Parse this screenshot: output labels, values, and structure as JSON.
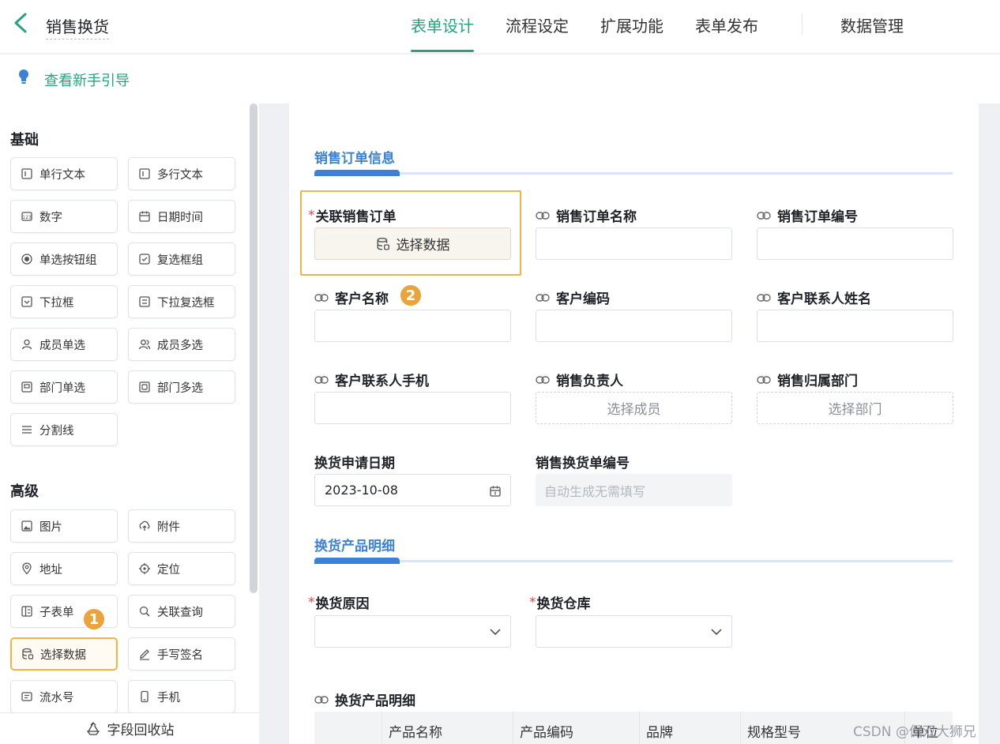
{
  "header": {
    "title": "销售换货",
    "tabs": [
      {
        "label": "表单设计",
        "active": true
      },
      {
        "label": "流程设定"
      },
      {
        "label": "扩展功能"
      },
      {
        "label": "表单发布"
      }
    ],
    "data_tab": "数据管理",
    "accent_color": "#27a37e"
  },
  "guide": {
    "label": "查看新手引导"
  },
  "left_panel": {
    "basic_title": "基础",
    "basic_items": [
      {
        "label": "单行文本",
        "icon": "text-single-icon"
      },
      {
        "label": "多行文本",
        "icon": "text-multi-icon"
      },
      {
        "label": "数字",
        "icon": "number-icon"
      },
      {
        "label": "日期时间",
        "icon": "calendar-icon"
      },
      {
        "label": "单选按钮组",
        "icon": "radio-icon"
      },
      {
        "label": "复选框组",
        "icon": "checkbox-icon"
      },
      {
        "label": "下拉框",
        "icon": "dropdown-icon"
      },
      {
        "label": "下拉复选框",
        "icon": "dropdown-multi-icon"
      },
      {
        "label": "成员单选",
        "icon": "user-icon"
      },
      {
        "label": "成员多选",
        "icon": "users-icon"
      },
      {
        "label": "部门单选",
        "icon": "dept-icon"
      },
      {
        "label": "部门多选",
        "icon": "dept-multi-icon"
      },
      {
        "label": "分割线",
        "icon": "divider-icon"
      }
    ],
    "advanced_title": "高级",
    "advanced_items": [
      {
        "label": "图片",
        "icon": "image-icon"
      },
      {
        "label": "附件",
        "icon": "upload-icon"
      },
      {
        "label": "地址",
        "icon": "pin-icon"
      },
      {
        "label": "定位",
        "icon": "locate-icon"
      },
      {
        "label": "子表单",
        "icon": "subform-icon"
      },
      {
        "label": "关联查询",
        "icon": "query-icon"
      },
      {
        "label": "选择数据",
        "icon": "database-icon",
        "selected": true
      },
      {
        "label": "手写签名",
        "icon": "pen-icon"
      },
      {
        "label": "流水号",
        "icon": "serial-icon"
      },
      {
        "label": "手机",
        "icon": "phone-icon"
      }
    ],
    "recycle_label": "字段回收站",
    "badge_1": "1"
  },
  "form": {
    "section1_title": "销售订单信息",
    "fields_row1": [
      {
        "label": "关联销售订单",
        "required": true,
        "button": "选择数据"
      },
      {
        "label": "销售订单名称",
        "linked": true
      },
      {
        "label": "销售订单编号",
        "linked": true
      }
    ],
    "fields_row2": [
      {
        "label": "客户名称",
        "linked": true
      },
      {
        "label": "客户编码",
        "linked": true
      },
      {
        "label": "客户联系人姓名",
        "linked": true
      }
    ],
    "badge_2": "2",
    "fields_row3": [
      {
        "label": "客户联系人手机",
        "linked": true
      },
      {
        "label": "销售负责人",
        "linked": true,
        "placeholder": "选择成员"
      },
      {
        "label": "销售归属部门",
        "linked": true,
        "placeholder": "选择部门"
      }
    ],
    "date_field": {
      "label": "换货申请日期",
      "value": "2023-10-08"
    },
    "serial_field": {
      "label": "销售换货单编号",
      "placeholder": "自动生成无需填写"
    },
    "section2_title": "换货产品明细",
    "reason_field": {
      "label": "换货原因",
      "required": true
    },
    "warehouse_field": {
      "label": "换货仓库",
      "required": true
    },
    "subtable": {
      "label": "换货产品明细",
      "columns": [
        "产品名称",
        "产品编码",
        "品牌",
        "规格型号",
        "单位"
      ]
    },
    "section_color": "#3b82d6"
  },
  "watermark": "CSDN @侃双大狮兄"
}
